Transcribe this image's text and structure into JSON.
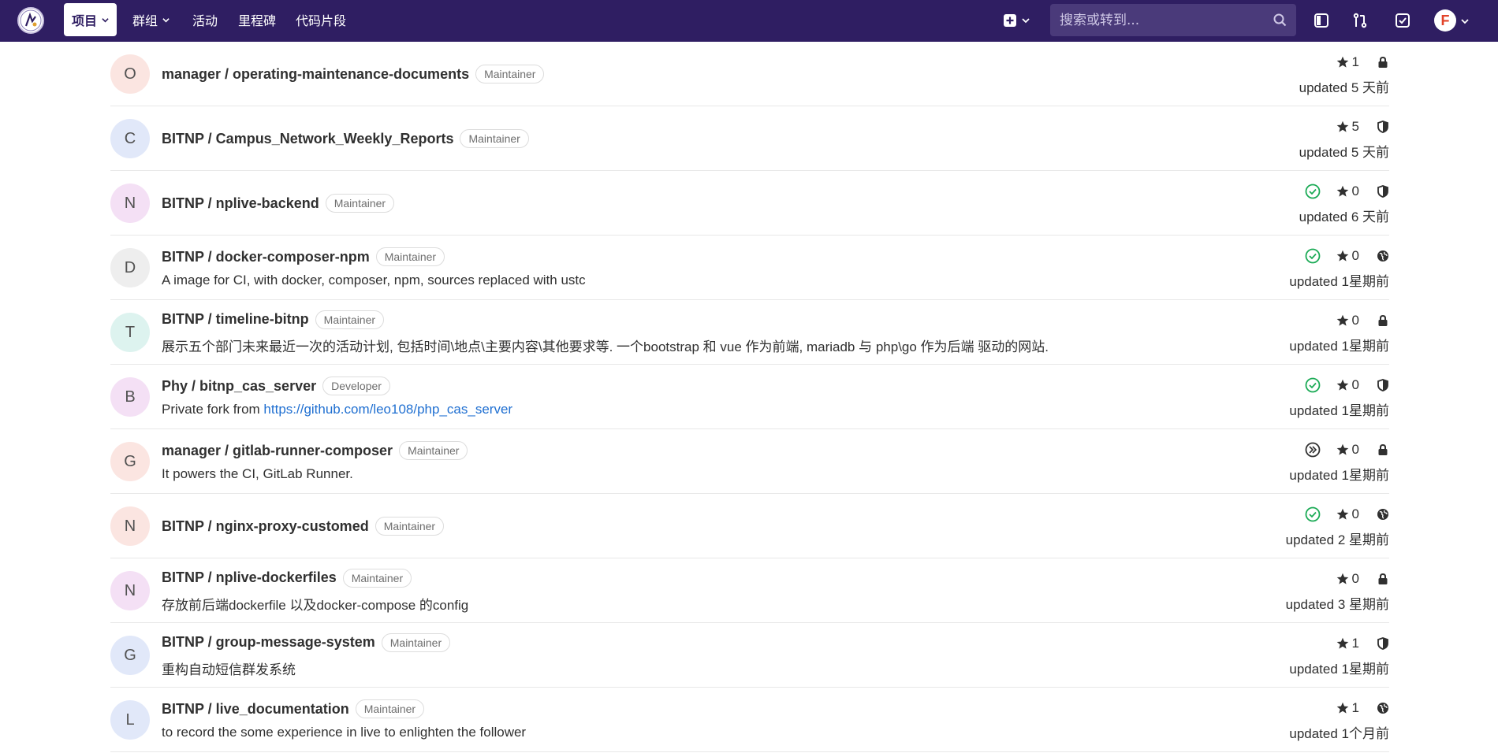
{
  "nav": {
    "projects_label": "项目",
    "groups_label": "群组",
    "activity_label": "活动",
    "milestones_label": "里程碑",
    "snippets_label": "代码片段",
    "search_placeholder": "搜索或转到...",
    "user_initial": "F"
  },
  "projects": [
    {
      "initial": "O",
      "avatar_color": "#fbe5e1",
      "name": "manager / operating-maintenance-documents",
      "role": "Maintainer",
      "description": "",
      "stars": "1",
      "visibility": "private",
      "pipeline": "none",
      "updated": "updated 5 天前"
    },
    {
      "initial": "C",
      "avatar_color": "#e1e8f9",
      "name": "BITNP / Campus_Network_Weekly_Reports",
      "role": "Maintainer",
      "description": "",
      "stars": "5",
      "visibility": "internal",
      "pipeline": "none",
      "updated": "updated 5 天前"
    },
    {
      "initial": "N",
      "avatar_color": "#f4e0f5",
      "name": "BITNP / nplive-backend",
      "role": "Maintainer",
      "description": "",
      "stars": "0",
      "visibility": "internal",
      "pipeline": "success",
      "updated": "updated 6 天前"
    },
    {
      "initial": "D",
      "avatar_color": "#eeeeee",
      "name": "BITNP / docker-composer-npm",
      "role": "Maintainer",
      "description": "A image for CI, with docker, composer, npm, sources replaced with ustc",
      "stars": "0",
      "visibility": "public",
      "pipeline": "success",
      "updated": "updated 1星期前"
    },
    {
      "initial": "T",
      "avatar_color": "#ddf3ef",
      "name": "BITNP / timeline-bitnp",
      "role": "Maintainer",
      "description": "展示五个部门未来最近一次的活动计划, 包括时间\\地点\\主要内容\\其他要求等. 一个bootstrap 和 vue 作为前端, mariadb 与 php\\go 作为后端 驱动的网站.",
      "stars": "0",
      "visibility": "private",
      "pipeline": "none",
      "updated": "updated 1星期前"
    },
    {
      "initial": "B",
      "avatar_color": "#f4e0f5",
      "name": "Phy / bitnp_cas_server",
      "role": "Developer",
      "description": "Private fork from ",
      "link": "https://github.com/leo108/php_cas_server",
      "stars": "0",
      "visibility": "internal",
      "pipeline": "success",
      "updated": "updated 1星期前"
    },
    {
      "initial": "G",
      "avatar_color": "#fbe5e1",
      "name": "manager / gitlab-runner-composer",
      "role": "Maintainer",
      "description": "It powers the CI, GitLab Runner.",
      "stars": "0",
      "visibility": "private",
      "pipeline": "skipped",
      "updated": "updated 1星期前"
    },
    {
      "initial": "N",
      "avatar_color": "#fbe5e1",
      "name": "BITNP / nginx-proxy-customed",
      "role": "Maintainer",
      "description": "",
      "stars": "0",
      "visibility": "public",
      "pipeline": "success",
      "updated": "updated 2 星期前"
    },
    {
      "initial": "N",
      "avatar_color": "#f4e0f5",
      "name": "BITNP / nplive-dockerfiles",
      "role": "Maintainer",
      "description": "存放前后端dockerfile 以及docker-compose 的config",
      "stars": "0",
      "visibility": "private",
      "pipeline": "none",
      "updated": "updated 3 星期前"
    },
    {
      "initial": "G",
      "avatar_color": "#e1e8f9",
      "name": "BITNP / group-message-system",
      "role": "Maintainer",
      "description": "重构自动短信群发系统",
      "stars": "1",
      "visibility": "internal",
      "pipeline": "none",
      "updated": "updated 1星期前"
    },
    {
      "initial": "L",
      "avatar_color": "#e1e8f9",
      "name": "BITNP / live_documentation",
      "role": "Maintainer",
      "description": "to record the some experience in live to enlighten the follower",
      "stars": "1",
      "visibility": "public",
      "pipeline": "none",
      "updated": "updated 1个月前"
    }
  ]
}
